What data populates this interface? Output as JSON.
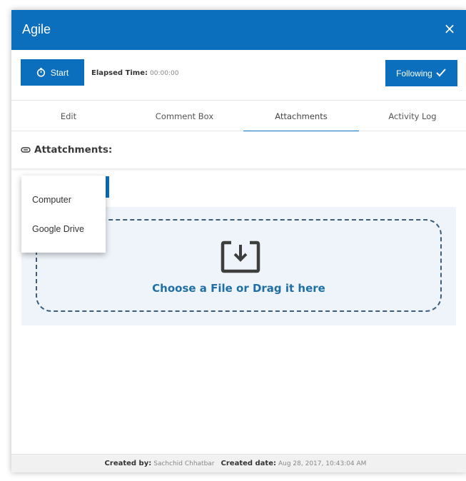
{
  "modal": {
    "title": "Agile",
    "close_glyph": "×"
  },
  "toolbar": {
    "start_label": "Start",
    "start_icon": "stopwatch-icon",
    "elapsed_label": "Elapsed Time:",
    "elapsed_value": "00:00:00",
    "following_label": "Following",
    "following_icon": "checkmark-icon"
  },
  "tabs": [
    {
      "label": "Edit",
      "active": false
    },
    {
      "label": "Comment Box",
      "active": false
    },
    {
      "label": "Attachments",
      "active": true
    },
    {
      "label": "Activity Log",
      "active": false
    }
  ],
  "attachments": {
    "heading": "Attatchments:",
    "heading_icon": "paperclip-icon",
    "dropdown": {
      "items": [
        "Computer",
        "Google Drive"
      ]
    },
    "drop_zone": {
      "icon": "download-tray-icon",
      "text": "Choose a File or Drag it here"
    }
  },
  "footer": {
    "created_by_label": "Created by:",
    "created_by_value": "Sachchid Chhatbar",
    "created_date_label": "Created date:",
    "created_date_value": "Aug 28, 2017, 10:43:04 AM"
  },
  "colors": {
    "primary": "#0b6fbd",
    "drop_text": "#1f6fa5",
    "drop_bg": "#eef4fa"
  }
}
